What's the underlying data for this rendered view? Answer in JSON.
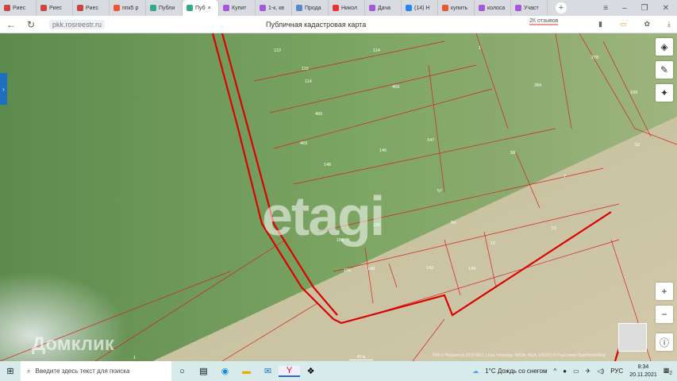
{
  "browser": {
    "tabs": [
      {
        "label": "Риес",
        "color": "#c44"
      },
      {
        "label": "Риес",
        "color": "#c44"
      },
      {
        "label": "Риес",
        "color": "#c44"
      },
      {
        "label": "ппк5 р",
        "color": "#e53"
      },
      {
        "label": "Публи",
        "color": "#3a8"
      },
      {
        "label": "Пуб",
        "color": "#3a8",
        "active": true
      },
      {
        "label": "Купит",
        "color": "#a5d"
      },
      {
        "label": "1-к, кв",
        "color": "#a5d"
      },
      {
        "label": "Прода",
        "color": "#58c"
      },
      {
        "label": "Никол",
        "color": "#e33"
      },
      {
        "label": "Дача",
        "color": "#a5d"
      },
      {
        "label": "(14) Н",
        "color": "#2787f5"
      },
      {
        "label": "купить",
        "color": "#e53"
      },
      {
        "label": "колоса",
        "color": "#a5d"
      },
      {
        "label": "Участ",
        "color": "#a5d"
      }
    ],
    "url": "pkk.rosreestr.ru",
    "page_title": "Публичная кадастровая карта",
    "reviews": "2К отзывов"
  },
  "map": {
    "watermark": "etagi",
    "watermark2": "Домклик",
    "attribution": "ПКК © Росреестр 2010-2021 | Esri, Intermap, NASA, NGA, USGS | © Участники OpenStreetMap",
    "scale": "40 м",
    "parcels": [
      "110",
      "114",
      "115",
      "114",
      "469",
      "469",
      "469",
      "1",
      "284",
      "278",
      "109",
      "52",
      "146",
      "147",
      "146",
      "58",
      "57",
      "7",
      "54",
      "53",
      "155",
      "156",
      "156",
      "148",
      "142",
      "149",
      "12",
      "1"
    ]
  },
  "taskbar": {
    "search_placeholder": "Введите здесь текст для поиска",
    "weather": "1°C  Дождь со снегом",
    "lang": "РУС",
    "time": "8:34",
    "date": "20.11.2021",
    "notifications": "2"
  }
}
